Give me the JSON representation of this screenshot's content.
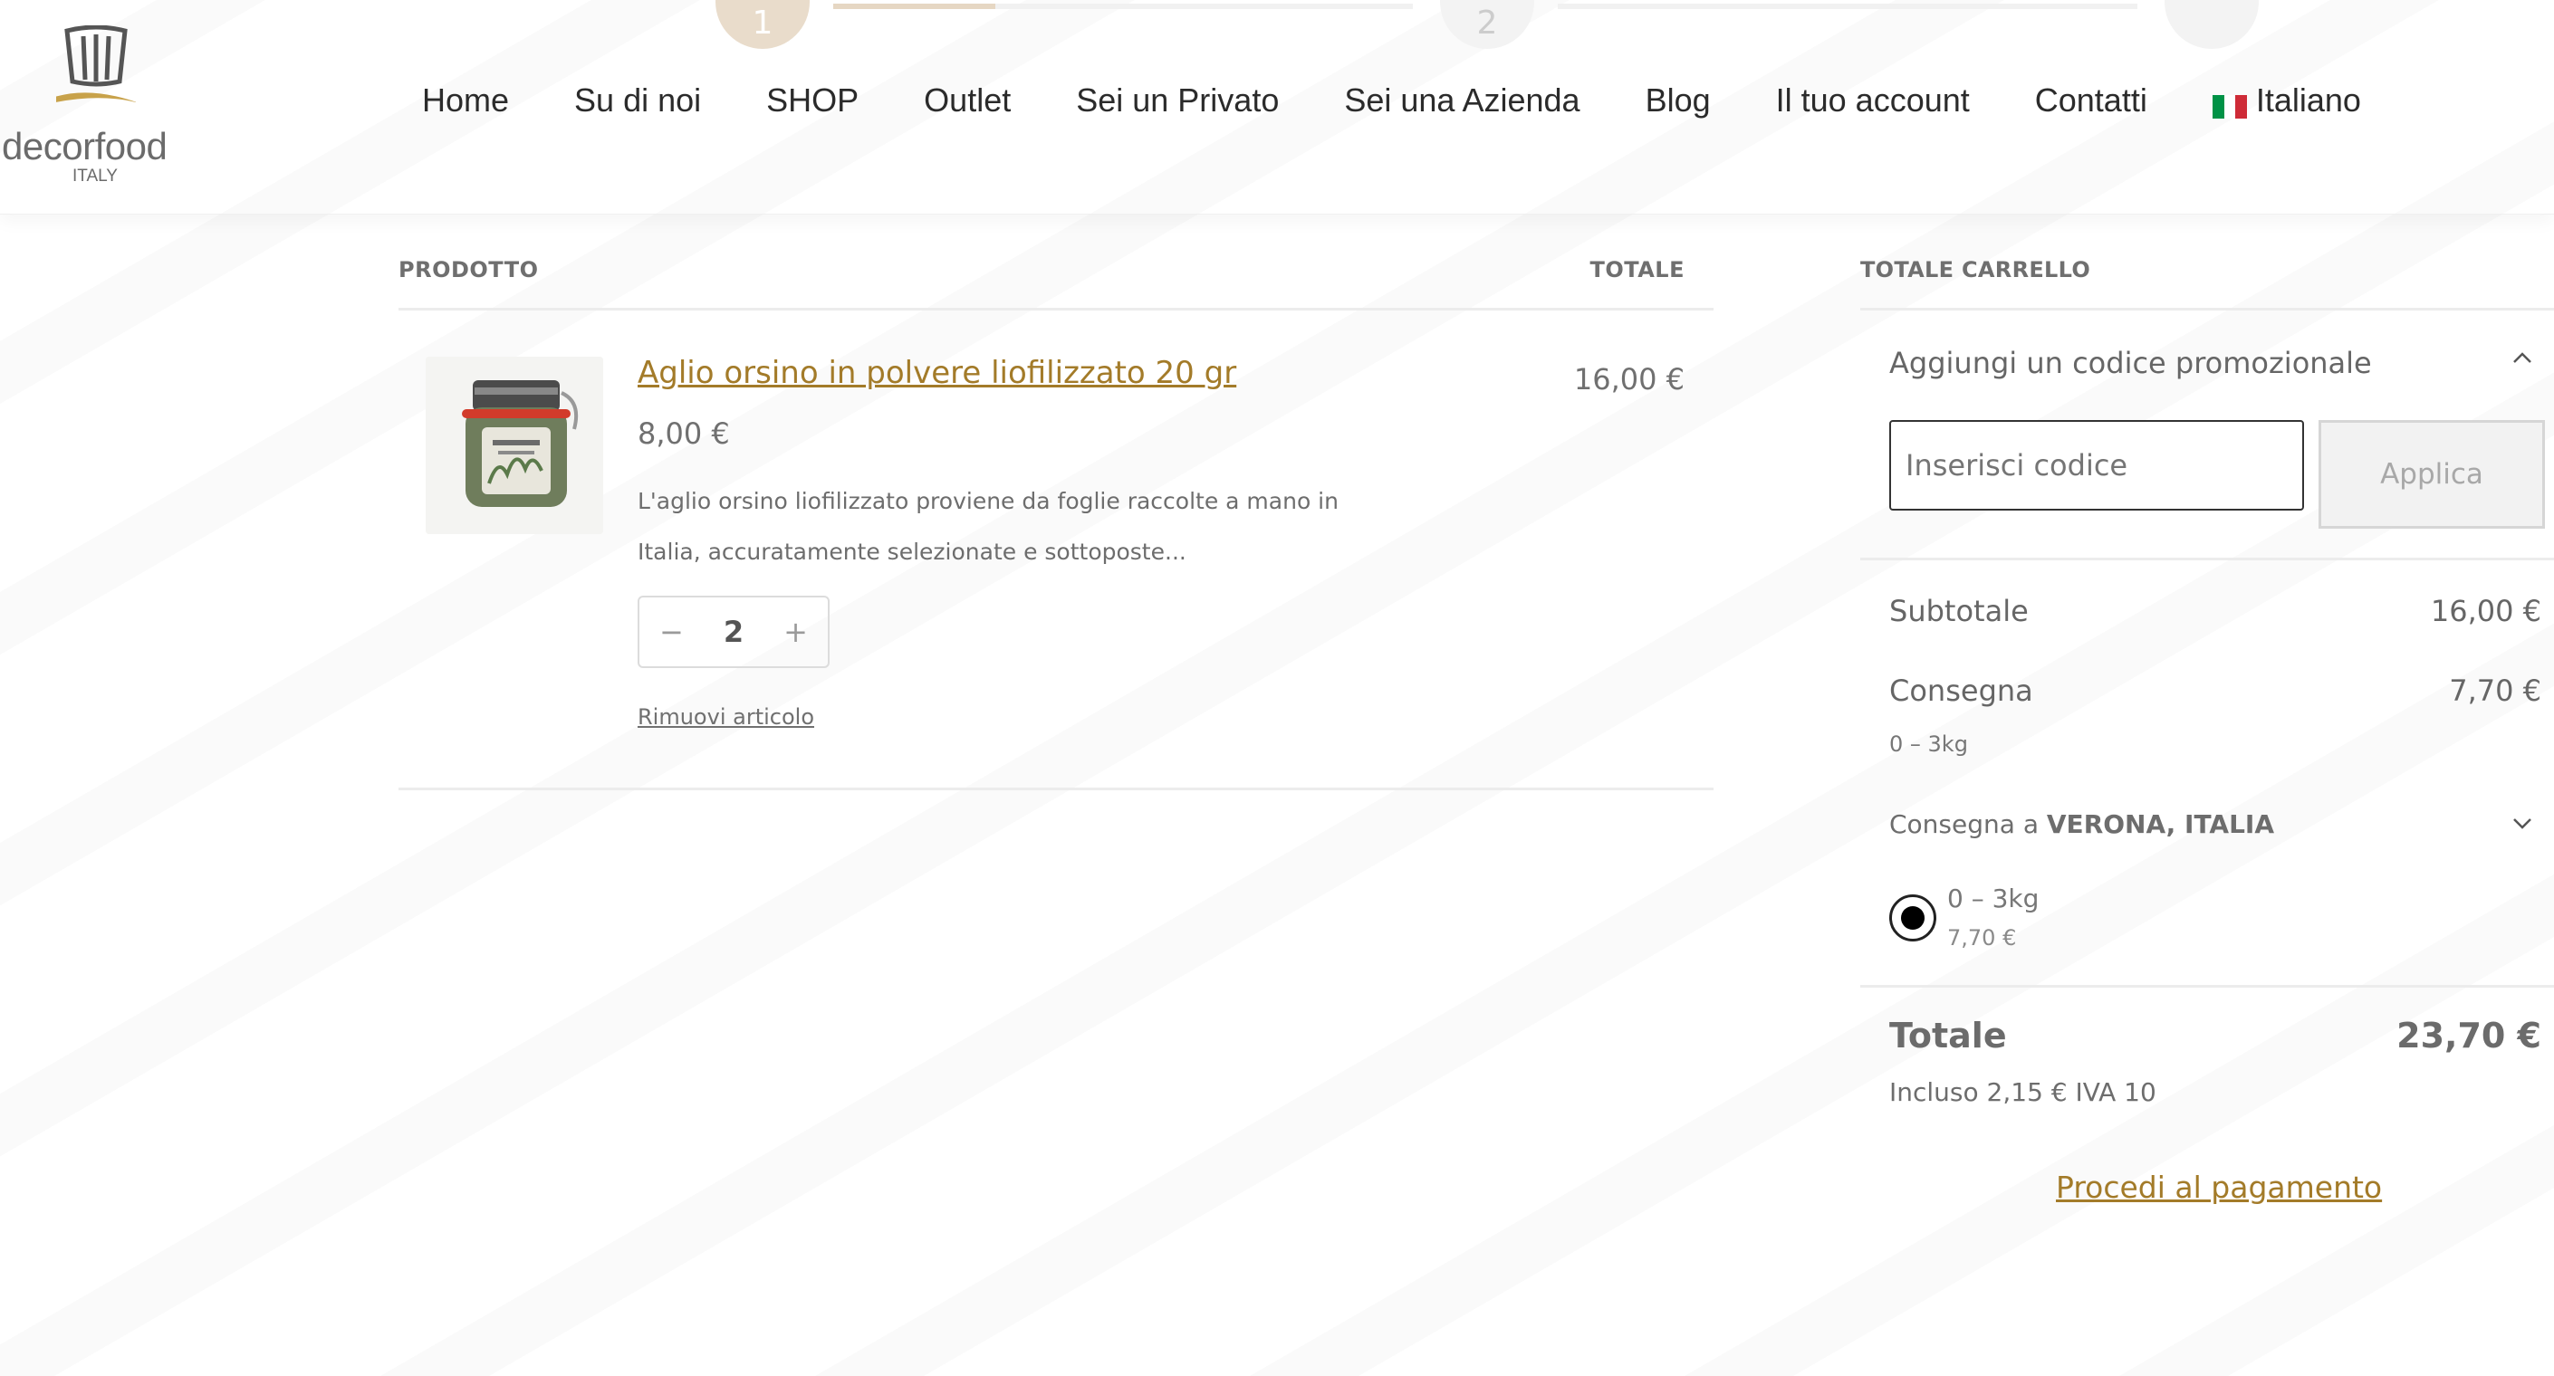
{
  "progress": {
    "step1_label": "1",
    "step2_label": "2",
    "step1_fill_fraction": 0.28
  },
  "logo": {
    "brand_part1": "decor",
    "brand_part2": "food",
    "country": "ITALY"
  },
  "nav": {
    "items": [
      "Home",
      "Su di noi",
      "SHOP",
      "Outlet",
      "Sei un Privato",
      "Sei una Azienda",
      "Blog",
      "Il tuo account",
      "Contatti"
    ],
    "language": "Italiano",
    "flag_colors": [
      "#009246",
      "#ffffff",
      "#ce2b37"
    ]
  },
  "cart": {
    "col_product": "PRODOTTO",
    "col_total": "TOTALE",
    "item": {
      "title": "Aglio orsino in polvere liofilizzato 20 gr",
      "price": "8,00 €",
      "description": "L'aglio orsino liofilizzato proviene da foglie raccolte a mano in Italia, accuratamente selezionate e sottoposte...",
      "quantity": "2",
      "decrease": "−",
      "increase": "+",
      "remove": "Rimuovi articolo",
      "line_total": "16,00 €"
    }
  },
  "totals": {
    "heading": "TOTALE CARRELLO",
    "promo_label": "Aggiungi un codice promozionale",
    "promo_placeholder": "Inserisci codice",
    "promo_button": "Applica",
    "subtotal_label": "Subtotale",
    "subtotal_value": "16,00 €",
    "shipping_label": "Consegna",
    "shipping_value": "7,70 €",
    "shipping_tier": "0 – 3kg",
    "ship_to_prefix": "Consegna a",
    "ship_to_place": "VERONA, ITALIA",
    "option_label": "0 – 3kg",
    "option_price": "7,70 €",
    "total_label": "Totale",
    "total_value": "23,70 €",
    "tax_note": "Incluso 2,15 € IVA 10",
    "checkout": "Procedi al pagamento"
  },
  "colors": {
    "accent": "#a37b29",
    "muted_text": "#6d6d6d"
  }
}
